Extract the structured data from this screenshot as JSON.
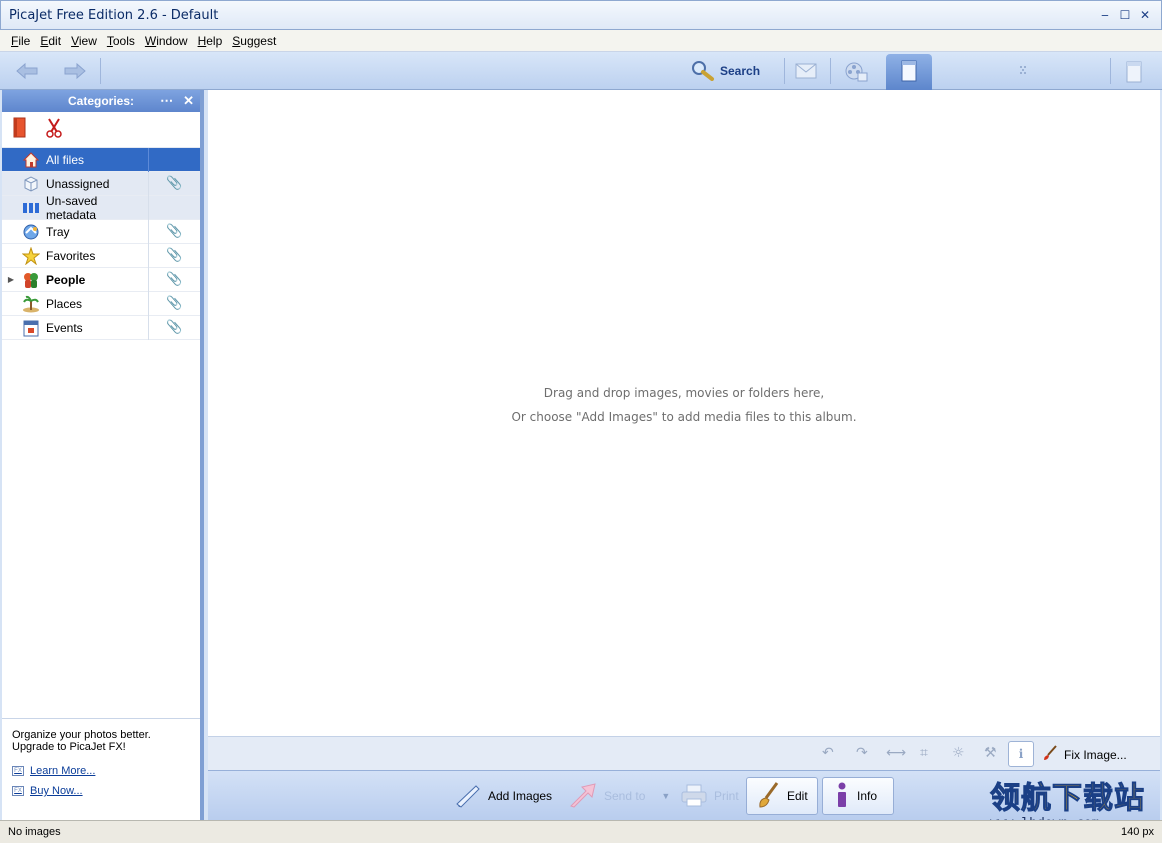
{
  "window": {
    "title": "PicaJet Free Edition 2.6  - Default",
    "controls": {
      "minimize": "‒",
      "maximize": "☐",
      "close": "✕"
    }
  },
  "menu": [
    "File",
    "Edit",
    "View",
    "Tools",
    "Window",
    "Help",
    "Suggest"
  ],
  "toolbar": {
    "search_label": "Search"
  },
  "categories": {
    "header": "Categories:",
    "items": [
      {
        "label": "All files",
        "icon": "home-icon",
        "selected": true,
        "clip": false
      },
      {
        "label": "Unassigned",
        "icon": "box-icon",
        "clip": true
      },
      {
        "label": "Un-saved metadata",
        "icon": "columns-icon",
        "clip": false
      },
      {
        "label": "Tray",
        "icon": "tray-icon",
        "clip": true
      },
      {
        "label": "Favorites",
        "icon": "star-icon",
        "clip": true
      },
      {
        "label": "People",
        "icon": "people-icon",
        "clip": true,
        "expandable": true
      },
      {
        "label": "Places",
        "icon": "island-icon",
        "clip": true
      },
      {
        "label": "Events",
        "icon": "calendar-icon",
        "clip": true
      }
    ]
  },
  "promo": {
    "line1": "Organize your photos better.",
    "line2": "Upgrade to PicaJet FX!",
    "learn_more": "Learn More...",
    "buy_now": "Buy Now..."
  },
  "main": {
    "hint_line1": "Drag and drop images, movies or folders here,",
    "hint_line2": "Or choose \"Add Images\" to add media files to this album."
  },
  "edit_tools": {
    "fix_image": "Fix Image..."
  },
  "actions": {
    "add_images": "Add Images",
    "send_to": "Send to",
    "print": "Print",
    "edit": "Edit",
    "info": "Info"
  },
  "status": {
    "left": "No images",
    "right": "140 px"
  },
  "watermark": {
    "cn": "领航下载站",
    "url": "www.lhdown.com"
  },
  "colors": {
    "selection": "#316ac5",
    "accent_blue": "#5e86cd"
  }
}
